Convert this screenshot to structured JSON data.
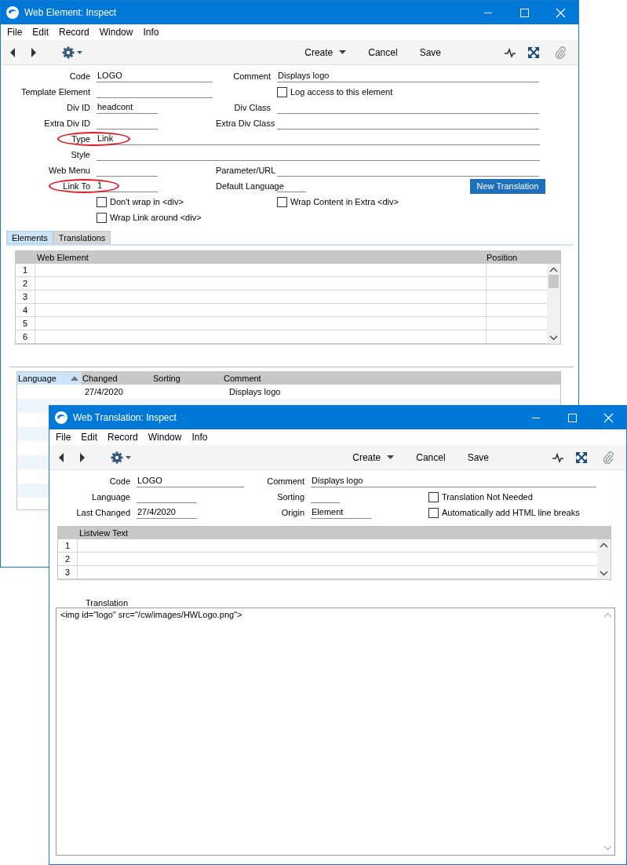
{
  "windows": [
    {
      "title": "Web Element: Inspect",
      "menu": [
        "File",
        "Edit",
        "Record",
        "Window",
        "Info"
      ],
      "toolbar": [
        {
          "label": "Create",
          "dropdown": true
        },
        {
          "label": "Cancel",
          "dropdown": false
        },
        {
          "label": "Save",
          "dropdown": false
        }
      ],
      "form": {
        "rows": [
          {
            "items": [
              {
                "kind": "field",
                "label": "Code",
                "value": "LOGO",
                "highlighted": false
              },
              {
                "kind": "field",
                "label": "Comment",
                "value": "Displays logo",
                "highlighted": false
              }
            ]
          },
          {
            "items": [
              {
                "kind": "field",
                "label": "Template Element",
                "highlighted": false
              },
              {
                "kind": "checkbox",
                "label": "Log access to this element",
                "checked": false
              }
            ]
          },
          {
            "items": [
              {
                "kind": "field",
                "label": "Div ID",
                "value": "headcont",
                "highlighted": false
              },
              {
                "kind": "field",
                "label": "Div Class",
                "highlighted": false
              }
            ]
          },
          {
            "items": [
              {
                "kind": "field",
                "label": "Extra Div ID",
                "highlighted": false
              },
              {
                "kind": "field",
                "label": "Extra Div Class",
                "highlighted": false
              }
            ]
          },
          {
            "items": [
              {
                "kind": "field",
                "label": "Type",
                "value": "Link",
                "highlighted": true
              }
            ]
          },
          {
            "items": [
              {
                "kind": "field",
                "label": "Style",
                "highlighted": false
              }
            ]
          },
          {
            "items": [
              {
                "kind": "field",
                "label": "Web Menu",
                "highlighted": false
              },
              {
                "kind": "field",
                "label": "Parameter/URL",
                "highlighted": false
              }
            ]
          },
          {
            "items": [
              {
                "kind": "field",
                "label": "Link To",
                "value": "1",
                "highlighted": true
              },
              {
                "kind": "field",
                "label": "Default Language",
                "highlighted": false
              },
              {
                "kind": "button",
                "label": "New Translation"
              }
            ]
          },
          {
            "items": [
              {
                "kind": "checkbox",
                "label": "Don't wrap in <div>",
                "checked": false
              },
              {
                "kind": "checkbox",
                "label": "Wrap Content in Extra <div>",
                "checked": false
              }
            ]
          },
          {
            "items": [
              {
                "kind": "checkbox",
                "label": "Wrap Link around <div>",
                "checked": false
              }
            ]
          }
        ]
      },
      "sections": [
        {
          "kind": "tabs",
          "tabs": [
            {
              "label": "Elements",
              "selected": true
            },
            {
              "label": "Translations",
              "selected": false
            }
          ]
        },
        {
          "kind": "grid",
          "columns": [
            "Web Element",
            "Position"
          ],
          "rows": [
            {
              "number": "1"
            },
            {
              "number": "2"
            },
            {
              "number": "3"
            },
            {
              "number": "4"
            },
            {
              "number": "5"
            },
            {
              "number": "6"
            }
          ]
        },
        {
          "kind": "list",
          "columns": [
            {
              "label": "Language",
              "sorted": true
            },
            {
              "label": "Changed",
              "sorted": false
            },
            {
              "label": "Sorting",
              "sorted": false
            },
            {
              "label": "Comment",
              "sorted": false
            }
          ],
          "rows": [
            {
              "changed": "27/4/2020",
              "comment": "Displays logo"
            }
          ]
        }
      ]
    },
    {
      "title": "Web Translation: Inspect",
      "menu": [
        "File",
        "Edit",
        "Record",
        "Window",
        "Info"
      ],
      "toolbar": [
        {
          "label": "Create",
          "dropdown": true
        },
        {
          "label": "Cancel",
          "dropdown": false
        },
        {
          "label": "Save",
          "dropdown": false
        }
      ],
      "form": {
        "rows": [
          {
            "items": [
              {
                "kind": "field",
                "label": "Code",
                "value": "LOGO",
                "highlighted": false
              },
              {
                "kind": "field",
                "label": "Comment",
                "value": "Displays logo",
                "highlighted": false
              }
            ]
          },
          {
            "items": [
              {
                "kind": "field",
                "label": "Language",
                "highlighted": false
              },
              {
                "kind": "field",
                "label": "Sorting",
                "highlighted": false
              },
              {
                "kind": "checkbox",
                "label": "Translation Not Needed",
                "checked": false
              }
            ]
          },
          {
            "items": [
              {
                "kind": "field",
                "label": "Last Changed",
                "value": "27/4/2020",
                "highlighted": false
              },
              {
                "kind": "field",
                "label": "Origin",
                "value": "Element",
                "highlighted": false
              },
              {
                "kind": "checkbox",
                "label": "Automatically add HTML line breaks",
                "checked": false
              }
            ]
          }
        ]
      },
      "sections": [
        {
          "kind": "grid",
          "columns": [
            "Listview Text"
          ],
          "rows": [
            {
              "number": "1"
            },
            {
              "number": "2"
            },
            {
              "number": "3"
            }
          ]
        },
        {
          "kind": "memo",
          "label": "Translation",
          "value": "<img id=\"logo\" src=\"/cw/images/HWLogo.png\">"
        }
      ]
    }
  ]
}
